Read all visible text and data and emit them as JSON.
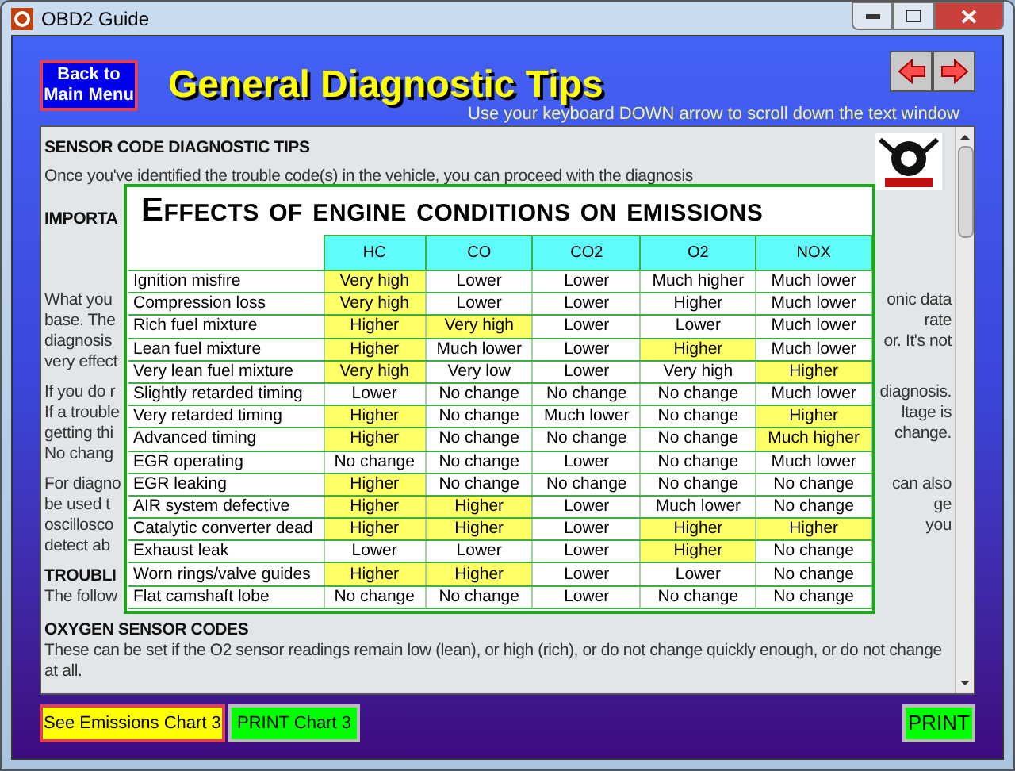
{
  "window": {
    "title": "OBD2 Guide"
  },
  "header": {
    "back_button": "Back to Main Menu",
    "title": "General Diagnostic Tips",
    "hint": "Use your keyboard DOWN arrow to scroll down the text window"
  },
  "text_window": {
    "paragraphs": [
      {
        "lines": [
          {
            "kind": "heading",
            "text": "SENSOR CODE DIAGNOSTIC TIPS"
          }
        ]
      },
      {
        "lines": [
          {
            "kind": "body",
            "text": "Once you've identified the trouble code(s) in the vehicle, you can proceed with the diagnosis"
          }
        ]
      },
      {
        "lines": [
          {
            "kind": "heading",
            "left": "IMPORTA"
          }
        ]
      },
      {
        "lines": [
          {
            "kind": "body",
            "left": "What you",
            "right": "onic data"
          },
          {
            "kind": "body",
            "left": "base. The",
            "right": "rate"
          },
          {
            "kind": "body",
            "left": "diagnosis",
            "right": "or. It's not"
          },
          {
            "kind": "body",
            "left": "very effect"
          }
        ]
      },
      {
        "lines": [
          {
            "kind": "body",
            "left": "If you do r",
            "right": "diagnosis."
          },
          {
            "kind": "body",
            "left": "If a trouble",
            "right": "ltage is"
          },
          {
            "kind": "body",
            "left": "getting thi",
            "right": "change."
          },
          {
            "kind": "body",
            "left": "No chang"
          }
        ]
      },
      {
        "lines": [
          {
            "kind": "body",
            "left": "For diagno",
            "right": "can also"
          },
          {
            "kind": "body",
            "left": "be used t",
            "right": "ge"
          },
          {
            "kind": "body",
            "left": "oscillosco",
            "right": "you"
          },
          {
            "kind": "body",
            "left": "detect ab"
          }
        ]
      },
      {
        "lines": [
          {
            "kind": "heading",
            "left": "TROUBLI"
          },
          {
            "kind": "body",
            "left": "The follow"
          }
        ]
      },
      {
        "lines": [
          {
            "kind": "heading",
            "text": "OXYGEN SENSOR CODES"
          },
          {
            "kind": "body",
            "text": "These can be set if the O2 sensor readings remain low (lean), or high (rich), or do not change quickly enough, or do not change at all."
          }
        ]
      }
    ]
  },
  "chart": {
    "title": "Effects of engine conditions on emissions",
    "columns": [
      "HC",
      "CO",
      "CO2",
      "O2",
      "NOX"
    ],
    "rows": [
      {
        "condition": "Ignition misfire",
        "cells": [
          {
            "text": "Very high",
            "highlighted": true
          },
          {
            "text": "Lower",
            "highlighted": false
          },
          {
            "text": "Lower",
            "highlighted": false
          },
          {
            "text": "Much higher",
            "highlighted": false
          },
          {
            "text": "Much lower",
            "highlighted": false
          }
        ]
      },
      {
        "condition": "Compression loss",
        "cells": [
          {
            "text": "Very high",
            "highlighted": true
          },
          {
            "text": "Lower",
            "highlighted": false
          },
          {
            "text": "Lower",
            "highlighted": false
          },
          {
            "text": "Higher",
            "highlighted": false
          },
          {
            "text": "Much lower",
            "highlighted": false
          }
        ]
      },
      {
        "condition": "Rich fuel mixture",
        "cells": [
          {
            "text": "Higher",
            "highlighted": true
          },
          {
            "text": "Very high",
            "highlighted": true
          },
          {
            "text": "Lower",
            "highlighted": false
          },
          {
            "text": "Lower",
            "highlighted": false
          },
          {
            "text": "Much lower",
            "highlighted": false
          }
        ]
      },
      {
        "condition": "Lean fuel mixture",
        "cells": [
          {
            "text": "Higher",
            "highlighted": true
          },
          {
            "text": "Much lower",
            "highlighted": false
          },
          {
            "text": "Lower",
            "highlighted": false
          },
          {
            "text": "Higher",
            "highlighted": true
          },
          {
            "text": "Much lower",
            "highlighted": false
          }
        ]
      },
      {
        "condition": "Very lean fuel mixture",
        "cells": [
          {
            "text": "Very high",
            "highlighted": true
          },
          {
            "text": "Very low",
            "highlighted": false
          },
          {
            "text": "Lower",
            "highlighted": false
          },
          {
            "text": "Very high",
            "highlighted": false
          },
          {
            "text": "Higher",
            "highlighted": true
          }
        ]
      },
      {
        "condition": "Slightly retarded timing",
        "cells": [
          {
            "text": "Lower",
            "highlighted": false
          },
          {
            "text": "No change",
            "highlighted": false
          },
          {
            "text": "No change",
            "highlighted": false
          },
          {
            "text": "No change",
            "highlighted": false
          },
          {
            "text": "Much lower",
            "highlighted": false
          }
        ]
      },
      {
        "condition": "Very retarded timing",
        "cells": [
          {
            "text": "Higher",
            "highlighted": true
          },
          {
            "text": "No change",
            "highlighted": false
          },
          {
            "text": "Much lower",
            "highlighted": false
          },
          {
            "text": "No change",
            "highlighted": false
          },
          {
            "text": "Higher",
            "highlighted": true
          }
        ]
      },
      {
        "condition": "Advanced timing",
        "cells": [
          {
            "text": "Higher",
            "highlighted": true
          },
          {
            "text": "No change",
            "highlighted": false
          },
          {
            "text": "No change",
            "highlighted": false
          },
          {
            "text": "No change",
            "highlighted": false
          },
          {
            "text": "Much higher",
            "highlighted": true
          }
        ]
      },
      {
        "condition": "EGR operating",
        "cells": [
          {
            "text": "No change",
            "highlighted": false
          },
          {
            "text": "No change",
            "highlighted": false
          },
          {
            "text": "Lower",
            "highlighted": false
          },
          {
            "text": "No change",
            "highlighted": false
          },
          {
            "text": "Much lower",
            "highlighted": false
          }
        ]
      },
      {
        "condition": "EGR leaking",
        "cells": [
          {
            "text": "Higher",
            "highlighted": true
          },
          {
            "text": "No change",
            "highlighted": false
          },
          {
            "text": "No change",
            "highlighted": false
          },
          {
            "text": "No change",
            "highlighted": false
          },
          {
            "text": "No change",
            "highlighted": false
          }
        ]
      },
      {
        "condition": "AIR system defective",
        "cells": [
          {
            "text": "Higher",
            "highlighted": true
          },
          {
            "text": "Higher",
            "highlighted": true
          },
          {
            "text": "Lower",
            "highlighted": false
          },
          {
            "text": "Much lower",
            "highlighted": false
          },
          {
            "text": "No change",
            "highlighted": false
          }
        ]
      },
      {
        "condition": "Catalytic converter dead",
        "cells": [
          {
            "text": "Higher",
            "highlighted": true
          },
          {
            "text": "Higher",
            "highlighted": true
          },
          {
            "text": "Lower",
            "highlighted": false
          },
          {
            "text": "Higher",
            "highlighted": true
          },
          {
            "text": "Higher",
            "highlighted": true
          }
        ]
      },
      {
        "condition": "Exhaust leak",
        "cells": [
          {
            "text": "Lower",
            "highlighted": false
          },
          {
            "text": "Lower",
            "highlighted": false
          },
          {
            "text": "Lower",
            "highlighted": false
          },
          {
            "text": "Higher",
            "highlighted": true
          },
          {
            "text": "No change",
            "highlighted": false
          }
        ]
      },
      {
        "condition": "Worn rings/valve guides",
        "cells": [
          {
            "text": "Higher",
            "highlighted": true
          },
          {
            "text": "Higher",
            "highlighted": true
          },
          {
            "text": "Lower",
            "highlighted": false
          },
          {
            "text": "Lower",
            "highlighted": false
          },
          {
            "text": "No change",
            "highlighted": false
          }
        ]
      },
      {
        "condition": "Flat camshaft lobe",
        "cells": [
          {
            "text": "No change",
            "highlighted": false
          },
          {
            "text": "No change",
            "highlighted": false
          },
          {
            "text": "Lower",
            "highlighted": false
          },
          {
            "text": "No change",
            "highlighted": false
          },
          {
            "text": "No change",
            "highlighted": false
          }
        ]
      }
    ]
  },
  "footer": {
    "buttons": [
      {
        "kind": "yellow",
        "label": "See Emissions Chart 3"
      },
      {
        "kind": "green",
        "label": "PRINT Chart 3"
      }
    ],
    "print_button": "PRINT"
  }
}
